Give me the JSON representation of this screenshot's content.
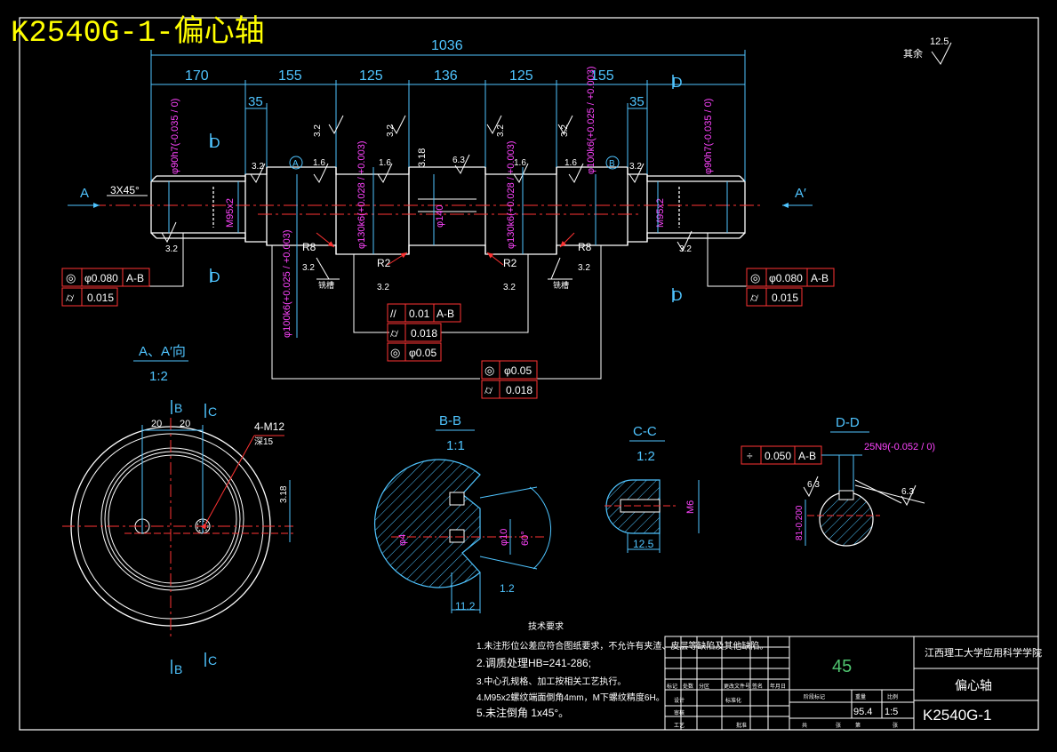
{
  "drawing": {
    "title": "K2540G-1-偏心轴",
    "overall_length": "1036",
    "segments": [
      "170",
      "155",
      "125",
      "136",
      "125",
      "155"
    ],
    "shoulders": [
      "35",
      "35"
    ],
    "section_marks": {
      "A": "A",
      "A2": "A′",
      "D": "D",
      "B": "B",
      "C": "C",
      "ref_a": "A",
      "ref_b": "B"
    },
    "chamfer": "3X45°",
    "roughness": {
      "r32": "3.2",
      "r16": "1.6",
      "r63": "6.3",
      "r125": "12.5",
      "rest": "其余"
    },
    "diameters": {
      "d90h7": "φ90h7(-0.035 / 0)",
      "m95": "M95x2",
      "d100k6": "φ100k6(+0.025 / +0.003)",
      "d130k6": "φ130k6(+0.028 / +0.003)",
      "d140": "φ140",
      "step318": "3.18"
    },
    "radii": [
      "R8",
      "R2",
      "R2",
      "R8"
    ],
    "undercut": "铣槽",
    "tolerance_frames": {
      "left": [
        [
          "◎",
          "φ0.080",
          "A-B"
        ],
        [
          "⌭",
          "0.015"
        ]
      ],
      "right": [
        [
          "◎",
          "φ0.080",
          "A-B"
        ],
        [
          "⌭",
          "0.015"
        ]
      ],
      "middle": [
        [
          "//",
          "0.01",
          "A-B"
        ],
        [
          "⌭",
          "0.018"
        ],
        [
          "◎",
          "φ0.05"
        ]
      ],
      "lower": [
        [
          "◎",
          "φ0.05"
        ],
        [
          "⌭",
          "0.018"
        ]
      ]
    },
    "view_aa": {
      "title": "A、A′向",
      "scale": "1:2",
      "dim1": "20",
      "dim2": "20",
      "holes": "4-M12",
      "depth": "深15",
      "offset": "3.18"
    },
    "view_bb": {
      "title": "B-B",
      "scale": "1:1",
      "d4": "φ4",
      "d10": "φ10",
      "angle": "60°",
      "w112": "11.2",
      "w12": "1.2"
    },
    "view_cc": {
      "title": "C-C",
      "scale": "1:2",
      "m6": "M6",
      "w125": "12.5"
    },
    "view_dd": {
      "title": "D-D",
      "tol_sym": "÷",
      "tol_val": "0.050",
      "tol_ref": "A-B",
      "key": "25N9(-0.052 / 0)",
      "depth": "81-0.200",
      "r63": "6.3"
    },
    "tech_req": {
      "heading": "技术要求",
      "items": [
        "1.未注形位公差应符合图纸要求，不允许有夹渣、皮层等缺陷及其他缺陷。",
        "2.调质处理HB=241-286;",
        "3.中心孔规格、加工按相关工艺执行。",
        "4.M95x2螺纹端面倒角4mm，M下螺纹精度6H。",
        "5.未注倒角 1x45°。"
      ]
    },
    "title_block": {
      "material": "45",
      "school": "江西理工大学应用科学学院",
      "part_name": "偏心轴",
      "drawing_no": "K2540G-1",
      "weight": "95.4",
      "scale": "1:5",
      "labels": [
        "标记",
        "处数",
        "分区",
        "更改文件号",
        "签名",
        "年月日",
        "设计",
        "标准化",
        "阶段标记",
        "重量",
        "比例",
        "审核",
        "工艺",
        "批准",
        "共",
        "张",
        "第",
        "张"
      ]
    }
  }
}
